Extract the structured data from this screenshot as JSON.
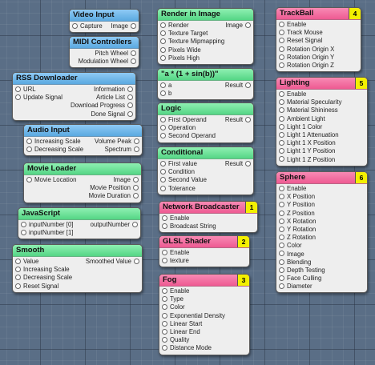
{
  "patches": [
    {
      "id": "video-input",
      "title": "Video Input",
      "color": "blue",
      "inputs": [
        "Capture"
      ],
      "outputs": [
        "Image"
      ]
    },
    {
      "id": "midi-controllers",
      "title": "MIDI Controllers",
      "color": "blue",
      "inputs": [],
      "outputs": [
        "Pitch Wheel",
        "Modulation Wheel"
      ]
    },
    {
      "id": "rss-downloader",
      "title": "RSS Downloader",
      "color": "blue",
      "inputs": [
        "URL",
        "Update Signal"
      ],
      "outputs": [
        "Information",
        "Article List",
        "Download Progress",
        "Done Signal"
      ]
    },
    {
      "id": "audio-input",
      "title": "Audio Input",
      "color": "blue",
      "inputs": [
        "Increasing Scale",
        "Decreasing Scale"
      ],
      "outputs": [
        "Volume Peak",
        "Spectrum"
      ]
    },
    {
      "id": "movie-loader",
      "title": "Movie Loader",
      "color": "green",
      "inputs": [
        "Movie Location"
      ],
      "outputs": [
        "Image",
        "Movie Position",
        "Movie Duration"
      ]
    },
    {
      "id": "javascript",
      "title": "JavaScript",
      "color": "green",
      "inputs": [
        "inputNumber [0]",
        "inputNumber [1]"
      ],
      "outputs": [
        "outputNumber"
      ]
    },
    {
      "id": "smooth",
      "title": "Smooth",
      "color": "green",
      "inputs": [
        "Value",
        "Increasing Scale",
        "Decreasing Scale",
        "Reset Signal"
      ],
      "outputs": [
        "Smoothed Value"
      ]
    },
    {
      "id": "render-in-image",
      "title": "Render in Image",
      "color": "green",
      "inputs": [
        "Render",
        "Texture Target",
        "Texture Mipmapping",
        "Pixels Wide",
        "Pixels High"
      ],
      "outputs": [
        "Image"
      ]
    },
    {
      "id": "math-expression",
      "title": "\"a * (1 + sin(b))\"",
      "color": "green",
      "inputs": [
        "a",
        "b"
      ],
      "outputs": [
        "Result"
      ]
    },
    {
      "id": "logic",
      "title": "Logic",
      "color": "green",
      "inputs": [
        "First Operand",
        "Operation",
        "Second Operand"
      ],
      "outputs": [
        "Result"
      ]
    },
    {
      "id": "conditional",
      "title": "Conditional",
      "color": "green",
      "inputs": [
        "First value",
        "Condition",
        "Second Value",
        "Tolerance"
      ],
      "outputs": [
        "Result"
      ]
    },
    {
      "id": "network-broadcaster",
      "title": "Network Broadcaster",
      "color": "pink",
      "badge": "1",
      "inputs": [
        "Enable",
        "Broadcast String"
      ],
      "outputs": []
    },
    {
      "id": "glsl-shader",
      "title": "GLSL Shader",
      "color": "pink",
      "badge": "2",
      "inputs": [
        "Enable",
        "texture"
      ],
      "outputs": []
    },
    {
      "id": "fog",
      "title": "Fog",
      "color": "pink",
      "badge": "3",
      "inputs": [
        "Enable",
        "Type",
        "Color",
        "Exponential Density",
        "Linear Start",
        "Linear End",
        "Quality",
        "Distance Mode"
      ],
      "outputs": []
    },
    {
      "id": "trackball",
      "title": "TrackBall",
      "color": "pink",
      "badge": "4",
      "inputs": [
        "Enable",
        "Track Mouse",
        "Reset Signal",
        "Rotation Origin X",
        "Rotation Origin Y",
        "Rotation Origin Z"
      ],
      "outputs": []
    },
    {
      "id": "lighting",
      "title": "Lighting",
      "color": "pink",
      "badge": "5",
      "inputs": [
        "Enable",
        "Material Specularity",
        "Material Shininess",
        "Ambient Light",
        "Light 1 Color",
        "Light 1 Attenuation",
        "Light 1 X Position",
        "Light 1 Y Position",
        "Light 1 Z Position"
      ],
      "outputs": []
    },
    {
      "id": "sphere",
      "title": "Sphere",
      "color": "pink",
      "badge": "6",
      "inputs": [
        "Enable",
        "X Position",
        "Y Position",
        "Z Position",
        "X Rotation",
        "Y Rotation",
        "Z Rotation",
        "Color",
        "Image",
        "Blending",
        "Depth Testing",
        "Face Culling",
        "Diameter"
      ],
      "outputs": []
    }
  ]
}
